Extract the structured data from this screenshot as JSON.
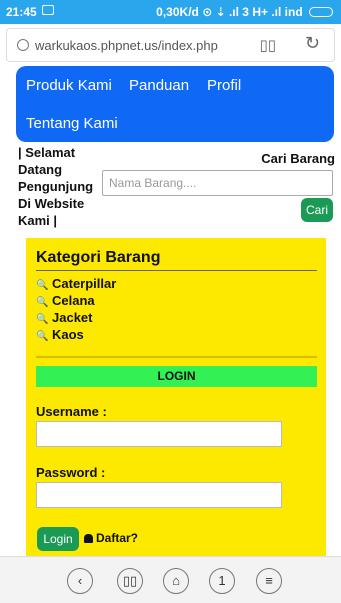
{
  "status": {
    "time": "21:45",
    "right_text": "0,30K/d ⊙ ⇣ .ıl 3 H+ .ıl ind"
  },
  "browser": {
    "url": "warkukaos.phpnet.us/index.php"
  },
  "nav": {
    "items": [
      "Produk Kami",
      "Panduan",
      "Profil",
      "Tentang Kami"
    ]
  },
  "welcome": {
    "lines": [
      "| Selamat",
      "Datang",
      "Pengunjung",
      "Di Website",
      "Kami |"
    ]
  },
  "search": {
    "title": "Cari Barang",
    "placeholder": "Nama Barang....",
    "button": "Cari"
  },
  "kategori": {
    "title": "Kategori Barang",
    "items": [
      "Caterpillar",
      "Celana",
      "Jacket",
      "Kaos"
    ]
  },
  "login": {
    "header": "LOGIN",
    "username_label": "Username :",
    "password_label": "Password :",
    "button": "Login",
    "daftar": "Daftar?"
  },
  "bottom_nav": {
    "tab_count": "1"
  },
  "colors": {
    "nav": "#0f69f5",
    "panel": "#fde800",
    "login_bar": "#33f055",
    "button": "#1b9a55"
  }
}
